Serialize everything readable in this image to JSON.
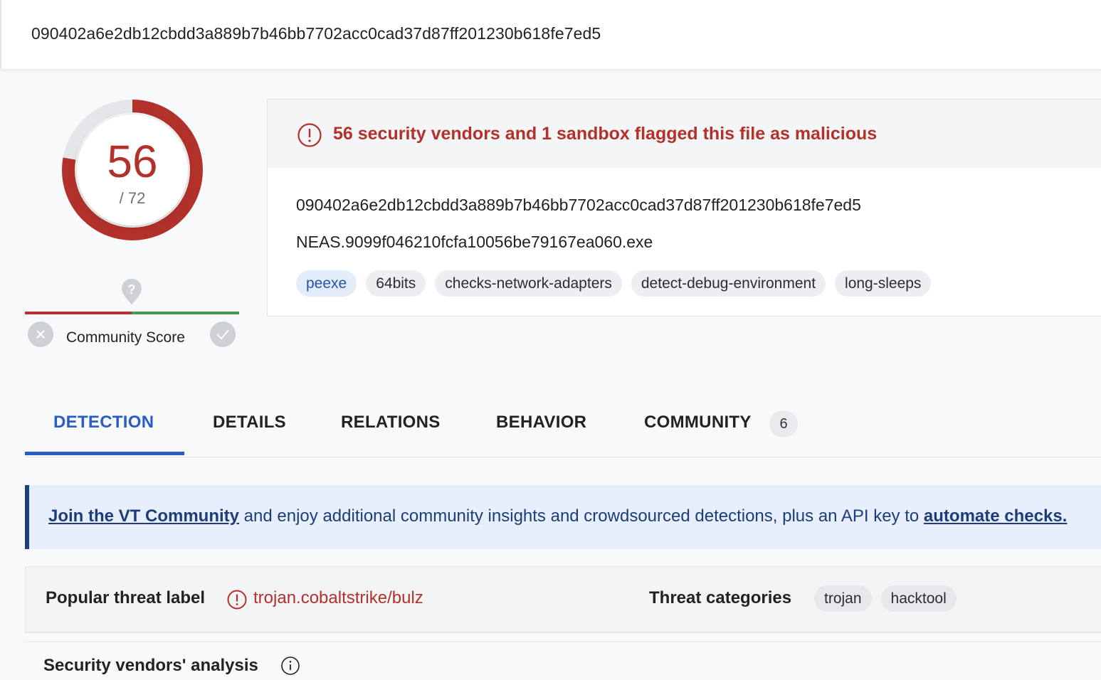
{
  "search": {
    "value": "090402a6e2db12cbdd3a889b7b46bb7702acc0cad37d87ff201230b618fe7ed5"
  },
  "score": {
    "detections": "56",
    "total": "/ 72",
    "fraction": 0.778
  },
  "community": {
    "label": "Community Score"
  },
  "alert": {
    "message": "56 security vendors and 1 sandbox flagged this file as malicious"
  },
  "file": {
    "hash": "090402a6e2db12cbdd3a889b7b46bb7702acc0cad37d87ff201230b618fe7ed5",
    "name": "NEAS.9099f046210fcfa10056be79167ea060.exe",
    "tags": [
      "peexe",
      "64bits",
      "checks-network-adapters",
      "detect-debug-environment",
      "long-sleeps"
    ]
  },
  "tabs": [
    {
      "label": "DETECTION"
    },
    {
      "label": "DETAILS"
    },
    {
      "label": "RELATIONS"
    },
    {
      "label": "BEHAVIOR"
    },
    {
      "label": "COMMUNITY",
      "badge": "6"
    }
  ],
  "banner": {
    "link1": "Join the VT Community",
    "text": " and enjoy additional community insights and crowdsourced detections, plus an API key to ",
    "link2": "automate checks."
  },
  "threat": {
    "label": "Popular threat label",
    "value": "trojan.cobaltstrike/bulz",
    "categories_label": "Threat categories",
    "categories": [
      "trojan",
      "hacktool"
    ]
  },
  "vendors": {
    "label": "Security vendors' analysis"
  },
  "colors": {
    "malicious": "#b3312b",
    "accent": "#2b5bc4",
    "harmless": "#4a9a4a"
  }
}
